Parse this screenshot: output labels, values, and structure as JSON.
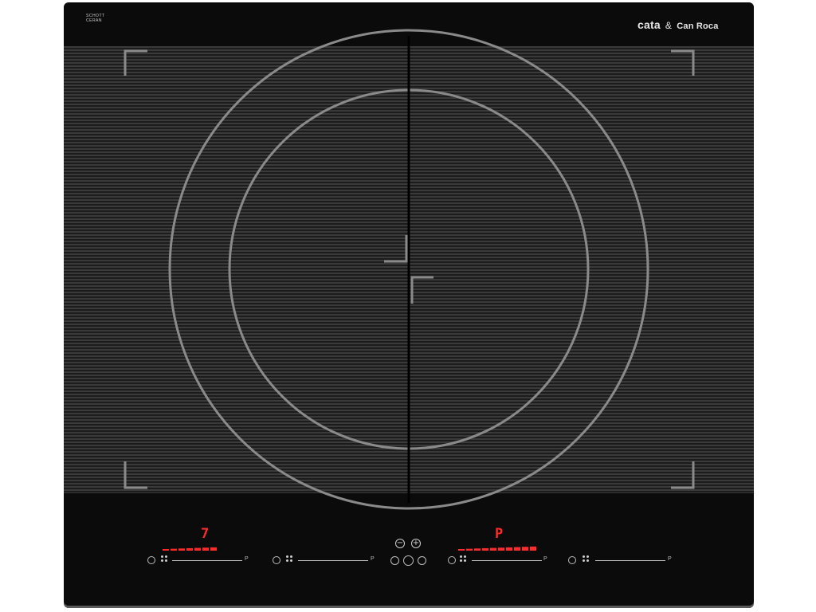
{
  "brand": {
    "name": "cata",
    "amp": "&",
    "partner": "Can Roca"
  },
  "glass_maker": {
    "line1": "SCHOTT",
    "line2": "CERAN"
  },
  "zones": [
    {
      "display": "7",
      "power_level_fraction": 0.7,
      "slider_end": "P"
    },
    {
      "display": "",
      "power_level_fraction": 0.0,
      "slider_end": "P"
    },
    {
      "display": "P",
      "power_level_fraction": 1.0,
      "slider_end": "P"
    },
    {
      "display": "",
      "power_level_fraction": 0.0,
      "slider_end": "P"
    }
  ],
  "timer": {
    "minus": "−",
    "plus": "+"
  },
  "colors": {
    "glass": "#0b0b0b",
    "stripe": "#3a3a3a",
    "ring": "#8a8a8a",
    "display": "#ff2a2a"
  }
}
